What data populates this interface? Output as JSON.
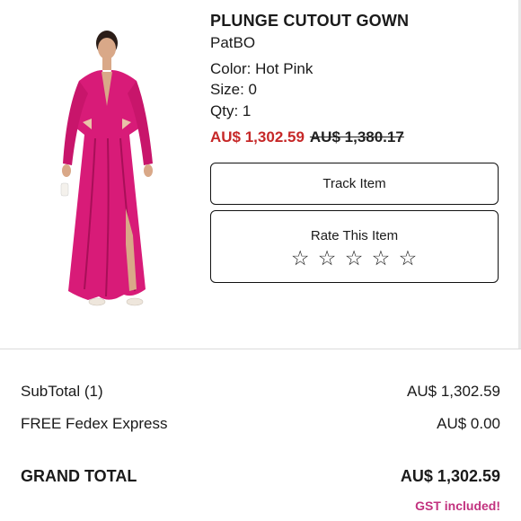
{
  "product": {
    "title": "PLUNGE CUTOUT GOWN",
    "brand": "PatBO",
    "color": "Color: Hot Pink",
    "size": "Size: 0",
    "qty": "Qty: 1",
    "sale_price": "AU$ 1,302.59",
    "original_price": "AU$ 1,380.17",
    "image_color": "#d81b78"
  },
  "actions": {
    "track_label": "Track Item",
    "rate_label": "Rate This Item",
    "stars": [
      "☆",
      "☆",
      "☆",
      "☆",
      "☆"
    ]
  },
  "summary": {
    "subtotal_label": "SubTotal (1)",
    "subtotal_value": "AU$ 1,302.59",
    "shipping_label": "FREE Fedex Express",
    "shipping_value": "AU$ 0.00",
    "grand_label": "GRAND TOTAL",
    "grand_value": "AU$ 1,302.59",
    "gst_note": "GST included!"
  },
  "colors": {
    "sale_red": "#c62828",
    "gst_pink": "#c2327f"
  }
}
